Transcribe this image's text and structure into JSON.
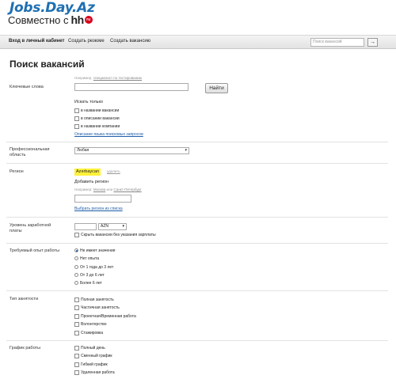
{
  "header": {
    "logo_text": "Jobs.Day.Az",
    "tagline": "Совместно с",
    "partner_logo": "hh",
    "partner_badge": "ru"
  },
  "nav": {
    "items": [
      {
        "label": "Вход в личный кабинет",
        "active": true
      },
      {
        "label": "Создать резюме",
        "active": false
      },
      {
        "label": "Создать вакансию",
        "active": false
      }
    ],
    "search_placeholder": "Поиск вакансий",
    "search_button": "→"
  },
  "page_title": "Поиск вакансий",
  "keywords": {
    "label": "Ключевые слова",
    "hint_prefix": "Например,",
    "hint_example": "специалист по тестированию",
    "search_button": "Найти",
    "search_only_label": "Искать только",
    "options": [
      "в названии вакансии",
      "в описании вакансии",
      "в названии компании"
    ],
    "lang_link": "Описание языка поисковых запросов"
  },
  "prof_area": {
    "label_line1": "Профессиональная",
    "label_line2": "область",
    "value": "Любая",
    "arrow": "▾"
  },
  "region": {
    "label": "Регион",
    "selected": "Azərbaycan",
    "remove": "удалить",
    "add_label": "Добавить регион",
    "hint_prefix": "Например:",
    "hint_ex1": "Москва",
    "hint_or": "или",
    "hint_ex2": "Санкт-Петербург",
    "list_link": "Выбрать регион из списка"
  },
  "salary": {
    "label_line1": "Уровень заработной",
    "label_line2": "платы",
    "currency": "AZN",
    "arrow": "▾",
    "hide_label": "Скрыть вакансии без указания зарплаты"
  },
  "experience": {
    "label": "Требуемый опыт работы",
    "options": [
      {
        "label": "Не имеет значения",
        "checked": true
      },
      {
        "label": "Нет опыта",
        "checked": false
      },
      {
        "label": "От 1 года до 3 лет",
        "checked": false
      },
      {
        "label": "От 3 до 6 лет",
        "checked": false
      },
      {
        "label": "Более 6 лет",
        "checked": false
      }
    ]
  },
  "employment": {
    "label": "Тип занятости",
    "options": [
      "Полная занятость",
      "Частичная занятость",
      "Проектная/Временная работа",
      "Волонтерство",
      "Стажировка"
    ]
  },
  "schedule": {
    "label": "График работы",
    "options": [
      "Полный день",
      "Сменный график",
      "Гибкий график",
      "Удаленная работа"
    ]
  }
}
